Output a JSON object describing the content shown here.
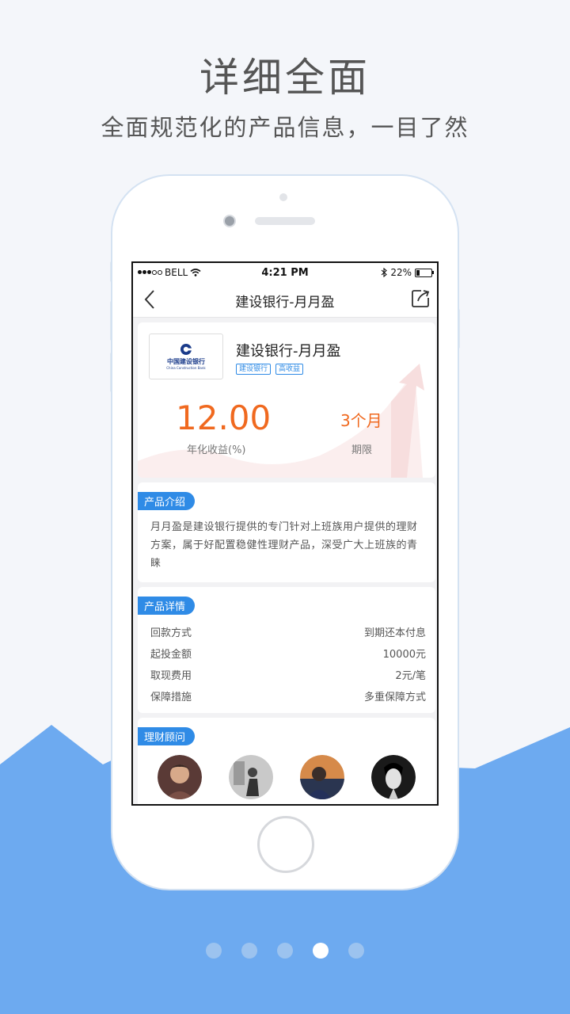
{
  "colors": {
    "accent": "#2f8be6",
    "rate": "#f0691f",
    "mountain": "#6daaf0"
  },
  "headline": "详细全面",
  "subline": "全面规范化的产品信息，一目了然",
  "status": {
    "carrier": "BELL",
    "time": "4:21 PM",
    "battery": "22%",
    "battery_level": 0.22
  },
  "nav": {
    "title": "建设银行-月月盈",
    "back_icon": "chevron-left-icon",
    "share_icon": "share-icon"
  },
  "product": {
    "name": "建设银行-月月盈",
    "logo": {
      "cn": "中国建设银行",
      "en": "China Construction Bank"
    },
    "tags": [
      "建设银行",
      "高收益"
    ],
    "rate_value": "12.00",
    "rate_label": "年化收益(%)",
    "term_value": "3个月",
    "term_label": "期限"
  },
  "intro": {
    "title": "产品介绍",
    "text": "月月盈是建设银行提供的专门针对上班族用户提供的理财方案，属于好配置稳健性理财产品，深受广大上班族的青睐"
  },
  "details": {
    "title": "产品详情",
    "rows": [
      {
        "label": "回款方式",
        "value": "到期还本付息"
      },
      {
        "label": "起投金额",
        "value": "10000元"
      },
      {
        "label": "取现费用",
        "value": "2元/笔"
      },
      {
        "label": "保障措施",
        "value": "多重保障方式"
      }
    ]
  },
  "advisors": {
    "title": "理财顾问",
    "count": 4
  },
  "pager": {
    "total": 5,
    "active": 4
  }
}
